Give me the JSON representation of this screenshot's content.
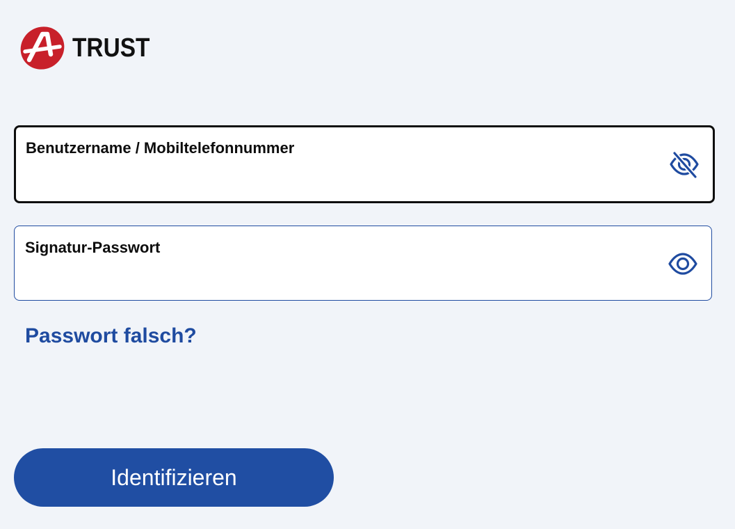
{
  "brand": {
    "logo_icon": "a-trust-logo-icon",
    "name": "TRUST",
    "logo_color": "#c8202a"
  },
  "form": {
    "username": {
      "label": "Benutzername / Mobiltelefonnummer",
      "value": "",
      "toggle_icon": "eye-slash-icon"
    },
    "password": {
      "label": "Signatur-Passwort",
      "value": "",
      "toggle_icon": "eye-icon"
    },
    "forgot_link": "Passwort falsch?",
    "submit_label": "Identifizieren"
  },
  "colors": {
    "background": "#f1f4f9",
    "accent": "#204ea3",
    "focus_border": "#0d0d0d"
  }
}
